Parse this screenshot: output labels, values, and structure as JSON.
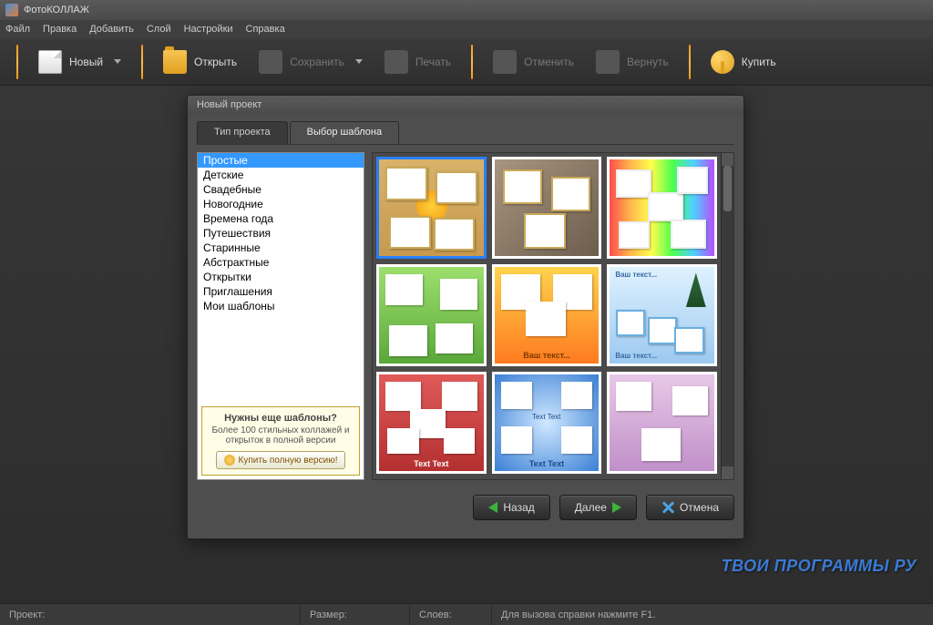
{
  "app": {
    "title": "ФотоКОЛЛАЖ"
  },
  "menu": {
    "file": "Файл",
    "edit": "Правка",
    "add": "Добавить",
    "layer": "Слой",
    "settings": "Настройки",
    "help": "Справка"
  },
  "toolbar": {
    "new": "Новый",
    "open": "Открыть",
    "save": "Сохранить",
    "print": "Печать",
    "undo": "Отменить",
    "redo": "Вернуть",
    "buy": "Купить"
  },
  "dialog": {
    "title": "Новый проект",
    "tabs": {
      "project_type": "Тип проекта",
      "template": "Выбор шаблона"
    },
    "categories": [
      "Простые",
      "Детские",
      "Свадебные",
      "Новогодние",
      "Времена года",
      "Путешествия",
      "Старинные",
      "Абстрактные",
      "Открытки",
      "Приглашения",
      "Мои шаблоны"
    ],
    "selected_category": 0,
    "promo": {
      "title": "Нужны еще шаблоны?",
      "text": "Более 100 стильных коллажей и открыток в полной версии",
      "button": "Купить полную версию!"
    },
    "buttons": {
      "back": "Назад",
      "next": "Далее",
      "cancel": "Отмена"
    }
  },
  "status": {
    "project_label": "Проект:",
    "size_label": "Размер:",
    "layers_label": "Слоев:",
    "help_hint": "Для вызова справки нажмите F1."
  },
  "watermark": "ТВОИ ПРОГРАММЫ РУ",
  "thumb_text": {
    "vash_tekst": "Ваш текст...",
    "text_text": "Text Text"
  }
}
